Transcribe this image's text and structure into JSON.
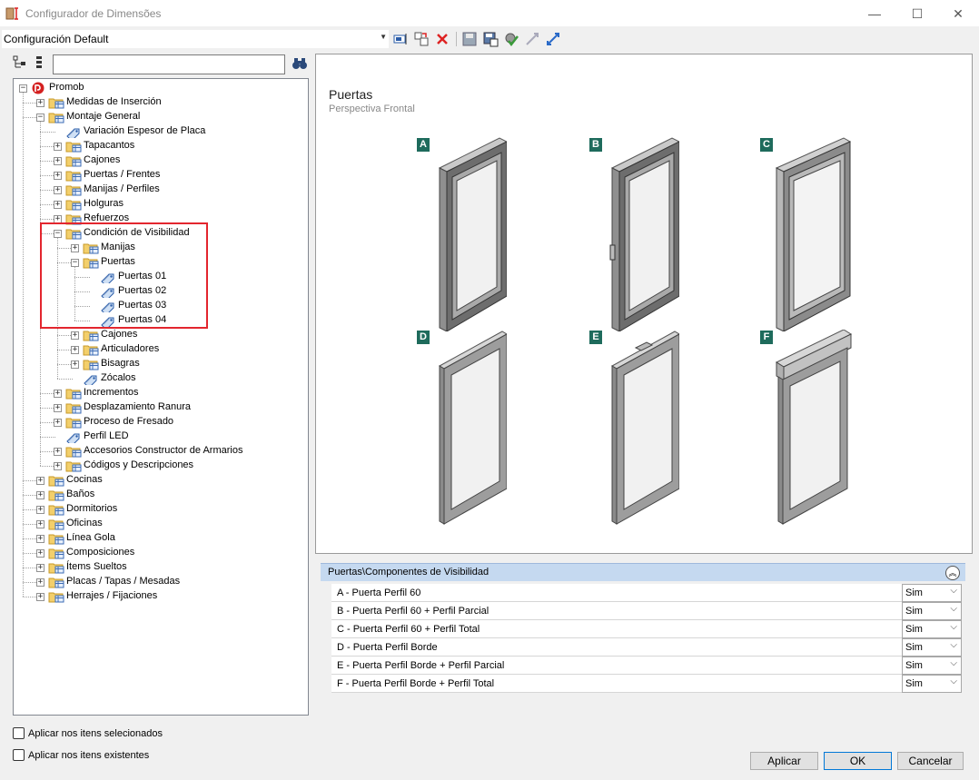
{
  "window": {
    "title": "Configurador de Dimensões",
    "minimize_glyph": "—",
    "maximize_glyph": "☐",
    "close_glyph": "✕"
  },
  "toolbar": {
    "config_value": "Configuración Default"
  },
  "tree": {
    "nodes": [
      {
        "label": "Promob",
        "icon": "promob-logo-icon",
        "expander": "−"
      },
      {
        "label": "Medidas de Inserción",
        "icon": "folder-table-icon",
        "expander": "+"
      },
      {
        "label": "Montaje General",
        "icon": "folder-table-icon",
        "expander": "−"
      },
      {
        "label": "Variación Espesor de Placa",
        "icon": "tag-icon",
        "expander": ""
      },
      {
        "label": "Tapacantos",
        "icon": "folder-table-icon",
        "expander": "+"
      },
      {
        "label": "Cajones",
        "icon": "folder-table-icon",
        "expander": "+"
      },
      {
        "label": "Puertas / Frentes",
        "icon": "folder-table-icon",
        "expander": "+"
      },
      {
        "label": "Manijas / Perfiles",
        "icon": "folder-table-icon",
        "expander": "+"
      },
      {
        "label": "Holguras",
        "icon": "folder-table-icon",
        "expander": "+"
      },
      {
        "label": "Refuerzos",
        "icon": "folder-table-icon",
        "expander": "+"
      },
      {
        "label": "Condición de Visibilidad",
        "icon": "folder-table-icon",
        "expander": "−"
      },
      {
        "label": "Manijas",
        "icon": "folder-table-icon",
        "expander": "+"
      },
      {
        "label": "Puertas",
        "icon": "folder-table-icon",
        "expander": "−"
      },
      {
        "label": "Puertas 01",
        "icon": "tag-icon",
        "expander": ""
      },
      {
        "label": "Puertas 02",
        "icon": "tag-icon",
        "expander": ""
      },
      {
        "label": "Puertas 03",
        "icon": "tag-icon",
        "expander": ""
      },
      {
        "label": "Puertas 04",
        "icon": "tag-icon",
        "expander": ""
      },
      {
        "label": "Cajones",
        "icon": "folder-table-icon",
        "expander": "+"
      },
      {
        "label": "Articuladores",
        "icon": "folder-table-icon",
        "expander": "+"
      },
      {
        "label": "Bisagras",
        "icon": "folder-table-icon",
        "expander": "+"
      },
      {
        "label": "Zócalos",
        "icon": "tag-icon",
        "expander": ""
      },
      {
        "label": "Incrementos",
        "icon": "folder-table-icon",
        "expander": "+"
      },
      {
        "label": "Desplazamiento Ranura",
        "icon": "folder-table-icon",
        "expander": "+"
      },
      {
        "label": "Proceso de Fresado",
        "icon": "folder-table-icon",
        "expander": "+"
      },
      {
        "label": "Perfil LED",
        "icon": "tag-icon",
        "expander": ""
      },
      {
        "label": "Accesorios Constructor de Armarios",
        "icon": "folder-table-icon",
        "expander": "+"
      },
      {
        "label": "Códigos y Descripciones",
        "icon": "folder-table-icon",
        "expander": "+"
      },
      {
        "label": "Cocinas",
        "icon": "folder-table-icon",
        "expander": "+"
      },
      {
        "label": "Baños",
        "icon": "folder-table-icon",
        "expander": "+"
      },
      {
        "label": "Dormitorios",
        "icon": "folder-table-icon",
        "expander": "+"
      },
      {
        "label": "Oficinas",
        "icon": "folder-table-icon",
        "expander": "+"
      },
      {
        "label": "Línea Gola",
        "icon": "folder-table-icon",
        "expander": "+"
      },
      {
        "label": "Composiciones",
        "icon": "folder-table-icon",
        "expander": "+"
      },
      {
        "label": "Ítems Sueltos",
        "icon": "folder-table-icon",
        "expander": "+"
      },
      {
        "label": "Placas / Tapas / Mesadas",
        "icon": "folder-table-icon",
        "expander": "+"
      },
      {
        "label": "Herrajes / Fijaciones",
        "icon": "folder-table-icon",
        "expander": "+"
      }
    ]
  },
  "options": {
    "apply_selected": "Aplicar nos itens selecionados",
    "apply_existing": "Aplicar nos itens existentes"
  },
  "preview": {
    "title": "Puertas",
    "subtitle": "Perspectiva Frontal",
    "tags": [
      "A",
      "B",
      "C",
      "D",
      "E",
      "F"
    ]
  },
  "properties": {
    "header": "Puertas\\Componentes de Visibilidad",
    "collapse_glyph": "︽",
    "rows": [
      {
        "label": "A - Puerta Perfil 60",
        "value": "Sim"
      },
      {
        "label": "B - Puerta Perfil 60 + Perfil Parcial",
        "value": "Sim"
      },
      {
        "label": "C - Puerta Perfil 60 + Perfil Total",
        "value": "Sim"
      },
      {
        "label": "D - Puerta Perfil Borde",
        "value": "Sim"
      },
      {
        "label": "E - Puerta Perfil Borde + Perfil Parcial",
        "value": "Sim"
      },
      {
        "label": "F - Puerta Perfil Borde + Perfil Total",
        "value": "Sim"
      }
    ]
  },
  "buttons": {
    "apply": "Aplicar",
    "ok": "OK",
    "cancel": "Cancelar"
  },
  "colors": {
    "highlight": "#e3262e",
    "tag_bg": "#1e6b5c",
    "grid_header": "#c5d9f0"
  }
}
